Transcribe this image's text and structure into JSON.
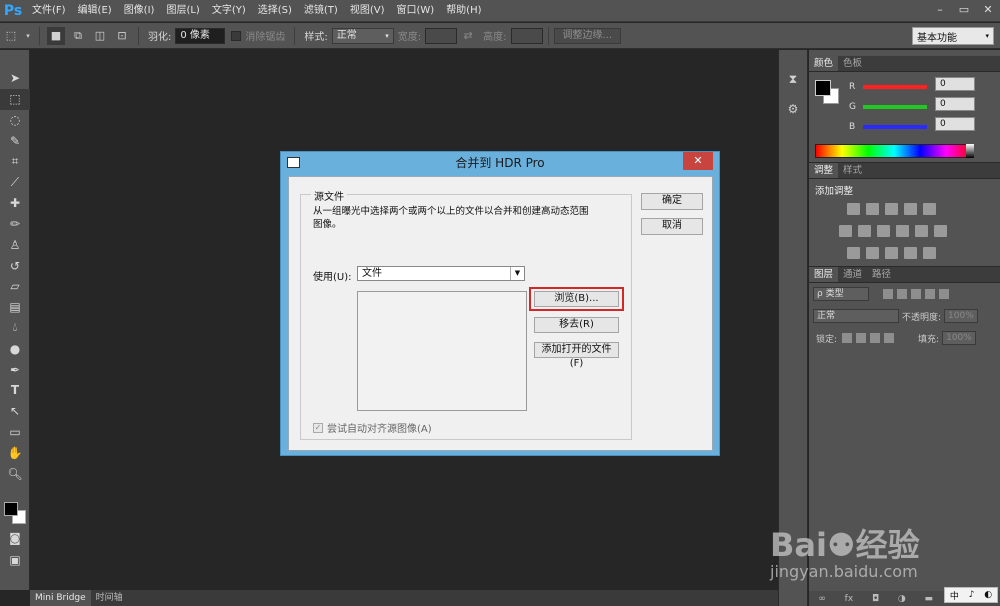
{
  "app": {
    "logo": "Ps",
    "menus": [
      "文件(F)",
      "编辑(E)",
      "图像(I)",
      "图层(L)",
      "文字(Y)",
      "选择(S)",
      "滤镜(T)",
      "视图(V)",
      "窗口(W)",
      "帮助(H)"
    ],
    "window_controls": [
      "–",
      "▭",
      "✕"
    ]
  },
  "options_bar": {
    "feather_label": "羽化:",
    "feather_value": "0 像素",
    "antialias_label": "消除锯齿",
    "style_label": "样式:",
    "style_value": "正常",
    "width_label": "宽度:",
    "height_label": "高度:",
    "refine_edge_button": "调整边缘...",
    "workspace": "基本功能"
  },
  "bottom_tabs": [
    "Mini Bridge",
    "时间轴"
  ],
  "color_panel": {
    "tabs": [
      "颜色",
      "色板"
    ],
    "channels": [
      {
        "label": "R",
        "value": "0",
        "color": "#ff2020"
      },
      {
        "label": "G",
        "value": "0",
        "color": "#20c820"
      },
      {
        "label": "B",
        "value": "0",
        "color": "#2a2aff"
      }
    ]
  },
  "adjustments_panel": {
    "tabs": [
      "调整",
      "样式"
    ],
    "title": "添加调整"
  },
  "layers_panel": {
    "tabs": [
      "图层",
      "通道",
      "路径"
    ],
    "kind_filter": "ρ 类型",
    "blend_mode": "正常",
    "opacity_label": "不透明度:",
    "opacity_value": "100%",
    "lock_label": "锁定:",
    "fill_label": "填充:",
    "fill_value": "100%"
  },
  "dialog": {
    "title": "合并到 HDR Pro",
    "close": "✕",
    "ok_button": "确定",
    "cancel_button": "取消",
    "source_legend": "源文件",
    "description": "从一组曝光中选择两个或两个以上的文件以合并和创建高动态范围图像。",
    "use_label": "使用(U):",
    "use_value": "文件",
    "browse_button": "浏览(B)...",
    "remove_button": "移去(R)",
    "add_open_button": "添加打开的文件(F)",
    "align_label": "尝试自动对齐源图像(A)",
    "align_checked": true
  },
  "watermark": {
    "logo": "Bai⚉经验",
    "url": "jingyan.baidu.com"
  },
  "ime": [
    "中",
    "♪",
    "◐"
  ]
}
